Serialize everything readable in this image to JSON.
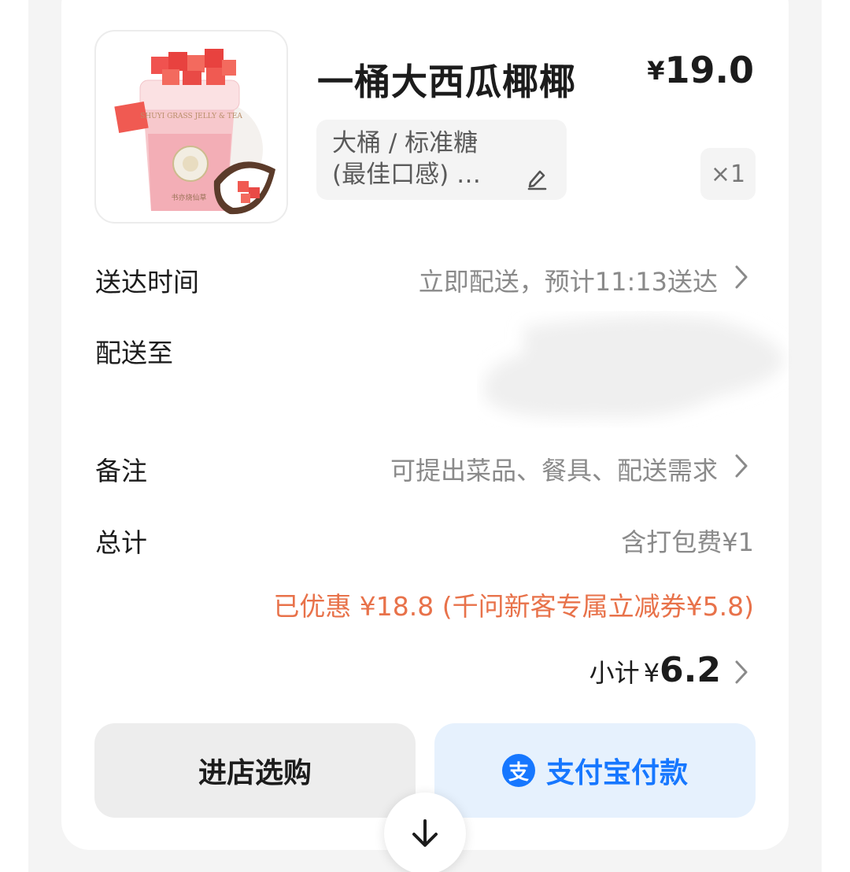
{
  "product": {
    "name": "一桶大西瓜椰椰",
    "currency": "¥",
    "price": "19.0",
    "spec_line1": "大桶 / 标准糖",
    "spec_line2": "(最佳口感) …",
    "quantity": "×1",
    "cup_text": "SHUYI GRASS JELLY & TEA",
    "brand_text": "书亦烧仙草"
  },
  "delivery": {
    "time_label": "送达时间",
    "time_value": "立即配送，预计11:13送达",
    "address_label": "配送至"
  },
  "remark": {
    "label": "备注",
    "placeholder": "可提出菜品、餐具、配送需求"
  },
  "total": {
    "label": "总计",
    "packing_fee": "含打包费¥1",
    "discount": "已优惠 ¥18.8 (千问新客专属立减券¥5.8)",
    "subtotal_label": "小计",
    "subtotal_currency": "¥",
    "subtotal_value": "6.2"
  },
  "actions": {
    "shop_label": "进店选购",
    "pay_label": "支付宝付款",
    "pay_logo_char": "支"
  },
  "icons": [
    "edit-icon",
    "chevron-right-icon",
    "alipay-icon",
    "arrow-down-icon"
  ],
  "colors": {
    "accent": "#1677ff",
    "discount": "#e8724a",
    "muted": "#8a8a8a"
  }
}
